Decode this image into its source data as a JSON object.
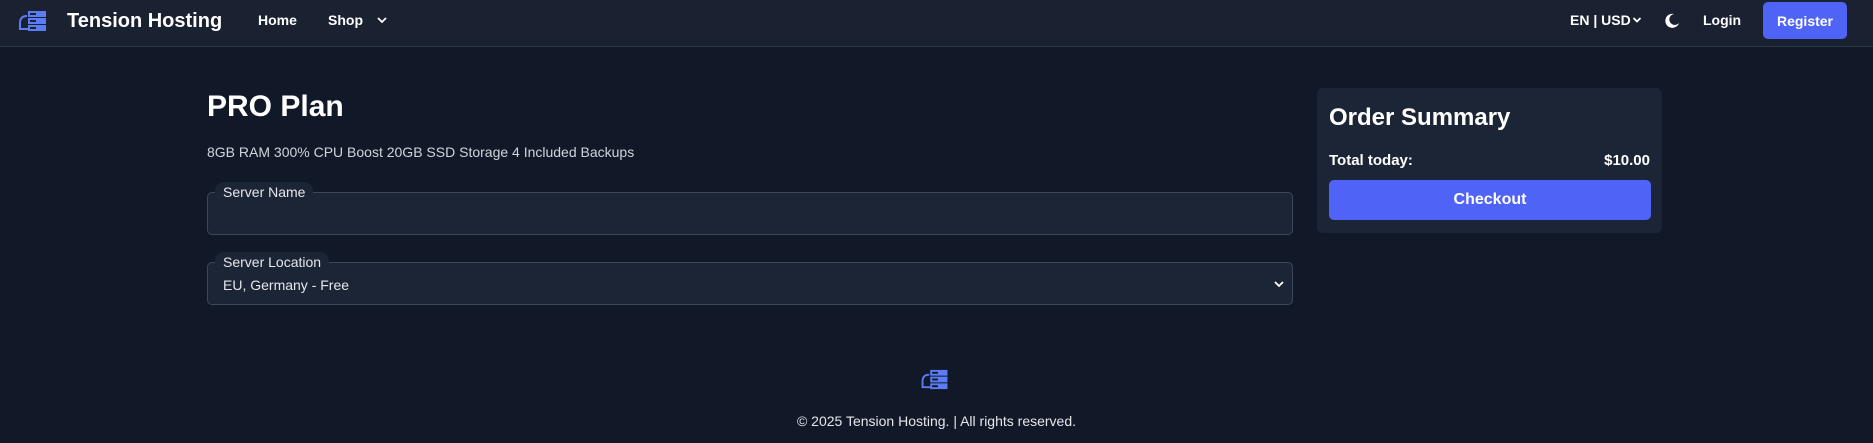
{
  "brand": {
    "name": "Tension Hosting",
    "icon": "server-stack-icon",
    "accent": "#4f63f7"
  },
  "nav": {
    "home": "Home",
    "shop": "Shop",
    "locale": "EN | USD",
    "theme_icon": "moon-icon",
    "login": "Login",
    "register": "Register"
  },
  "plan": {
    "title": "PRO Plan",
    "features": "8GB RAM 300% CPU Boost 20GB SSD Storage 4 Included Backups"
  },
  "form": {
    "server_name_label": "Server Name",
    "server_name_value": "",
    "server_location_label": "Server Location",
    "server_location_value": "EU, Germany - Free"
  },
  "summary": {
    "title": "Order Summary",
    "total_label": "Total today:",
    "total_value": "$10.00",
    "checkout": "Checkout"
  },
  "footer": {
    "text": "© 2025 Tension Hosting. | All rights reserved."
  }
}
